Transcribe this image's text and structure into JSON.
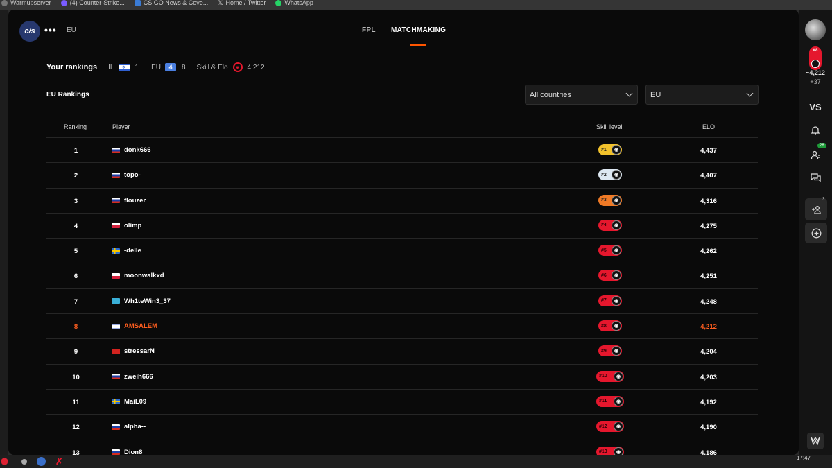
{
  "bookmarks": [
    {
      "label": "Warmupserver",
      "icon": "bookmark-icon"
    },
    {
      "label": "(4) Counter-Strike...",
      "icon": "bookmark-icon"
    },
    {
      "label": "CS:GO News & Cove...",
      "icon": "bookmark-icon"
    },
    {
      "label": "Home / Twitter",
      "icon": "x-icon"
    },
    {
      "label": "WhatsApp",
      "icon": "whatsapp-icon"
    }
  ],
  "header": {
    "logo_text": "c/s",
    "more_label": "•••",
    "region_label": "EU",
    "tabs": [
      {
        "label": "FPL",
        "active": false
      },
      {
        "label": "MATCHMAKING",
        "active": true
      }
    ]
  },
  "your_rankings": {
    "title": "Your rankings",
    "il_label": "IL",
    "il_rank": "1",
    "eu_label": "EU",
    "eu_rank": "8",
    "skill_label": "Skill & Elo",
    "elo": "4,212"
  },
  "section_title": "EU Rankings",
  "filters": {
    "country": "All countries",
    "region": "EU"
  },
  "table": {
    "headers": {
      "ranking": "Ranking",
      "player": "Player",
      "skill": "Skill level",
      "elo": "ELO"
    },
    "rows": [
      {
        "rank": "1",
        "player": "donk666",
        "flag": "ru",
        "level": "#1",
        "elo": "4,437",
        "badge_color": "#f2c22c",
        "me": false
      },
      {
        "rank": "2",
        "player": "topo-",
        "flag": "ru",
        "level": "#2",
        "elo": "4,407",
        "badge_color": "#dde8f2",
        "me": false
      },
      {
        "rank": "3",
        "player": "flouzer",
        "flag": "ru",
        "level": "#3",
        "elo": "4,316",
        "badge_color": "#f07a26",
        "me": false
      },
      {
        "rank": "4",
        "player": "olimp",
        "flag": "pl",
        "level": "#4",
        "elo": "4,275",
        "badge_color": "#e5172d",
        "me": false
      },
      {
        "rank": "5",
        "player": "-delle",
        "flag": "se",
        "level": "#5",
        "elo": "4,262",
        "badge_color": "#e5172d",
        "me": false
      },
      {
        "rank": "6",
        "player": "moonwalkxd",
        "flag": "pl",
        "level": "#6",
        "elo": "4,251",
        "badge_color": "#e5172d",
        "me": false
      },
      {
        "rank": "7",
        "player": "Wh1teWin3_37",
        "flag": "kz",
        "level": "#7",
        "elo": "4,248",
        "badge_color": "#e5172d",
        "me": false
      },
      {
        "rank": "8",
        "player": "AMSALEM",
        "flag": "il",
        "level": "#8",
        "elo": "4,212",
        "badge_color": "#e5172d",
        "me": true
      },
      {
        "rank": "9",
        "player": "stressarN",
        "flag": "mk",
        "level": "#9",
        "elo": "4,204",
        "badge_color": "#e5172d",
        "me": false
      },
      {
        "rank": "10",
        "player": "zweih666",
        "flag": "ru",
        "level": "#10",
        "elo": "4,203",
        "badge_color": "#e5172d",
        "me": false
      },
      {
        "rank": "11",
        "player": "MaiL09",
        "flag": "se",
        "level": "#11",
        "elo": "4,192",
        "badge_color": "#e5172d",
        "me": false
      },
      {
        "rank": "12",
        "player": "alpha--",
        "flag": "ru",
        "level": "#12",
        "elo": "4,190",
        "badge_color": "#e5172d",
        "me": false
      },
      {
        "rank": "13",
        "player": "Dion8",
        "flag": "ru",
        "level": "#13",
        "elo": "4,186",
        "badge_color": "#e5172d",
        "me": false
      }
    ]
  },
  "right_panel": {
    "level_badge": "#8",
    "elo": "~4,212",
    "elo_delta": "+37",
    "vs_label": "VS",
    "friends_count": "28",
    "party_count": "3"
  },
  "taskbar": {
    "time": "17:47"
  },
  "colors": {
    "accent": "#ff5500",
    "me_row": "#ff5e1f",
    "level_red": "#e5172d"
  }
}
